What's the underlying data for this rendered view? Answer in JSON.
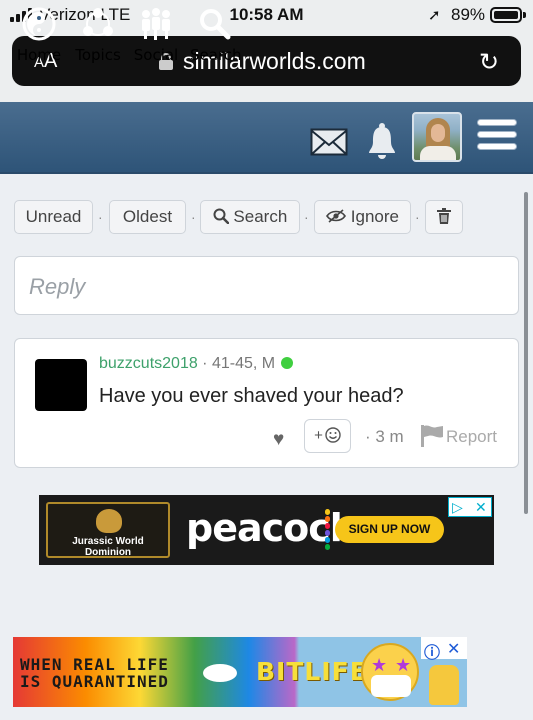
{
  "status_bar": {
    "carrier": "Verizon  LTE",
    "time": "10:58 AM",
    "battery": "89%",
    "battery_level": 0.89
  },
  "browser": {
    "text_size_label": "AA",
    "url": "similarworlds.com"
  },
  "nav": {
    "items": [
      {
        "label": "Home",
        "icon": "yin-yang-icon"
      },
      {
        "label": "Topics",
        "icon": "topics-icon"
      },
      {
        "label": "Social",
        "icon": "social-icon"
      },
      {
        "label": "Search",
        "icon": "search-icon"
      }
    ],
    "right_icons": [
      "mail-icon",
      "bell-icon",
      "avatar",
      "hamburger-menu-icon"
    ]
  },
  "toolbar": {
    "unread": "Unread",
    "oldest": "Oldest",
    "search": "Search",
    "ignore": "Ignore",
    "separator": "·"
  },
  "reply": {
    "placeholder": "Reply"
  },
  "post": {
    "username": "buzzcuts2018",
    "details": " · 41-45, M",
    "text": "Have you ever shaved your head?",
    "react_label": "+",
    "time": "· 3 m",
    "report": "Report"
  },
  "ads": {
    "ad1": {
      "brand_text": "Jurassic World Dominion",
      "logo": "peacock",
      "cta": "SIGN UP NOW"
    },
    "ad2": {
      "line1": "WHEN REAL LIFE",
      "line2": "IS QUARANTINED",
      "brand": "BITLIFE"
    }
  },
  "colors": {
    "nav_bg": "#3b6186",
    "username": "#3ea16b",
    "online": "#3fcf3f",
    "cta": "#f6c519"
  }
}
